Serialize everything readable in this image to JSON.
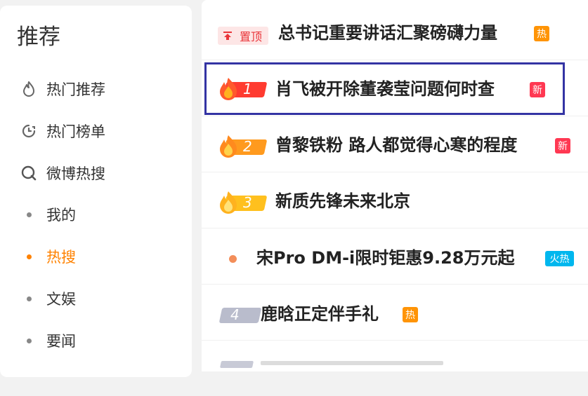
{
  "sidebar": {
    "title": "推荐",
    "items": [
      {
        "label": "热门推荐",
        "icon": "flame-outline-icon"
      },
      {
        "label": "热门榜单",
        "icon": "clock-chart-icon"
      },
      {
        "label": "微博热搜",
        "icon": "search-q-icon"
      }
    ],
    "sub_items": [
      {
        "label": "我的",
        "active": false
      },
      {
        "label": "热搜",
        "active": true
      },
      {
        "label": "文娱",
        "active": false
      },
      {
        "label": "要闻",
        "active": false
      }
    ],
    "active_color": "#ff8200"
  },
  "list": {
    "pinned": {
      "badge": "置顶",
      "title": "总书记重要讲话汇聚磅礴力量",
      "tag": "热"
    },
    "items": [
      {
        "rank": "1",
        "title": "肖飞被开除董袭莹问题何时查",
        "tag": "新"
      },
      {
        "rank": "2",
        "title": "曾黎铁粉 路人都觉得心寒的程度",
        "tag": "新"
      },
      {
        "rank": "3",
        "title": "新质先锋未来北京",
        "tag": ""
      },
      {
        "rank": "",
        "title": "宋Pro DM-i限时钜惠9.28万元起",
        "tag": "火热"
      },
      {
        "rank": "4",
        "title": "鹿晗正定伴手礼",
        "tag": "热"
      }
    ],
    "colors": {
      "rank1": "#ff3b30",
      "rank2": "#ff9a1e",
      "rank3": "#ffc01e",
      "rank_other": "#b9bccc",
      "hot_tag": "#ff9406",
      "new_tag": "#ff3852",
      "fire_tag": "#00b7ee"
    }
  }
}
